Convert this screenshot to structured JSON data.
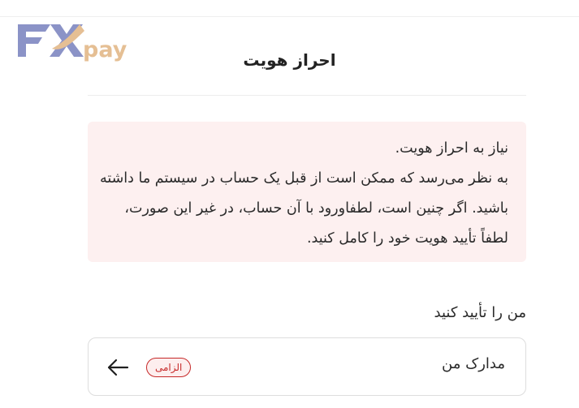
{
  "brand": {
    "logo_text": "FXpay",
    "primary": "#8b93c7",
    "accent": "#e5bf94"
  },
  "header": {
    "title": "احراز هویت"
  },
  "alert": {
    "line1": "نیاز به احراز هویت.",
    "line2": "به نظر می‌رسد که ممکن است از قبل یک حساب در سیستم ما داشته باشید. اگر چنین است، لطفاورود با آن حساب، در غیر این صورت، لطفاً تأیید هویت خود را کامل کنید.",
    "background": "#fdf0f0"
  },
  "verify": {
    "label": "من را تأیید کنید",
    "row": {
      "label": "مدارک من",
      "badge": "الزامی",
      "badge_color": "#c62828",
      "icon": "arrow-left-icon"
    }
  }
}
